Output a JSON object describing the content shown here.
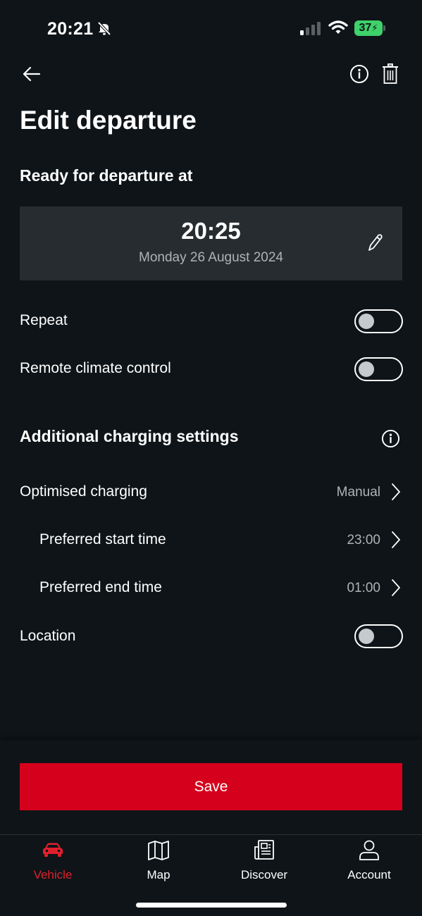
{
  "status_bar": {
    "time": "20:21",
    "battery": "37"
  },
  "header": {
    "title": "Edit departure",
    "subtitle": "Ready for departure at"
  },
  "departure": {
    "time": "20:25",
    "date": "Monday 26 August 2024"
  },
  "toggles": {
    "repeat_label": "Repeat",
    "repeat_on": false,
    "climate_label": "Remote climate control",
    "climate_on": false,
    "location_label": "Location",
    "location_on": false
  },
  "charging": {
    "section_title": "Additional charging settings",
    "optimised_label": "Optimised charging",
    "optimised_value": "Manual",
    "start_label": "Preferred start time",
    "start_value": "23:00",
    "end_label": "Preferred end time",
    "end_value": "01:00"
  },
  "actions": {
    "save_label": "Save"
  },
  "tabbar": {
    "tabs": [
      {
        "label": "Vehicle",
        "icon": "car-icon",
        "active": true
      },
      {
        "label": "Map",
        "icon": "map-icon",
        "active": false
      },
      {
        "label": "Discover",
        "icon": "news-icon",
        "active": false
      },
      {
        "label": "Account",
        "icon": "user-icon",
        "active": false
      }
    ]
  },
  "colors": {
    "background": "#0e1418",
    "card": "#272c30",
    "accent_red": "#d5001c",
    "active_tab": "#e0202c",
    "battery_green": "#3fd16a"
  }
}
